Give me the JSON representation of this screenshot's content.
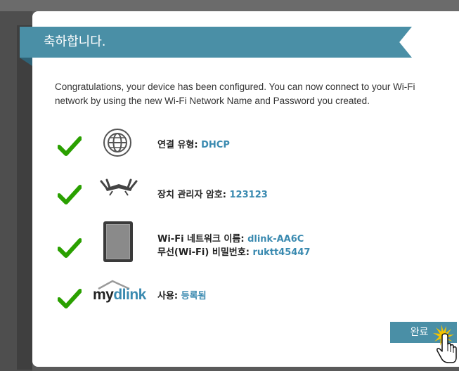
{
  "dialog": {
    "title": "축하합니다.",
    "intro": "Congratulations, your device has been configured. You can now connect to your Wi-Fi network by using the new Wi-Fi Network Name and Password you created."
  },
  "rows": [
    {
      "icon": "globe-icon",
      "label": "연결 유형:",
      "value": "DHCP"
    },
    {
      "icon": "router-icon",
      "label": "장치 관리자 암호:",
      "value": "123123"
    },
    {
      "icon": "tablet-icon",
      "label": "Wi-Fi 네트워크 이름:",
      "value": "dlink-AA6C",
      "label2": "무선(Wi-Fi) 비밀번호:",
      "value2": "ruktt45447"
    },
    {
      "icon": "mydlink-logo",
      "label": "사용:",
      "value": "등록됨"
    }
  ],
  "logo": {
    "my": "my",
    "dlink": "dlink"
  },
  "buttons": {
    "finish": "완료"
  },
  "colors": {
    "accent": "#4a8fa6",
    "check": "#2aa000",
    "value": "#3a8ab0"
  }
}
